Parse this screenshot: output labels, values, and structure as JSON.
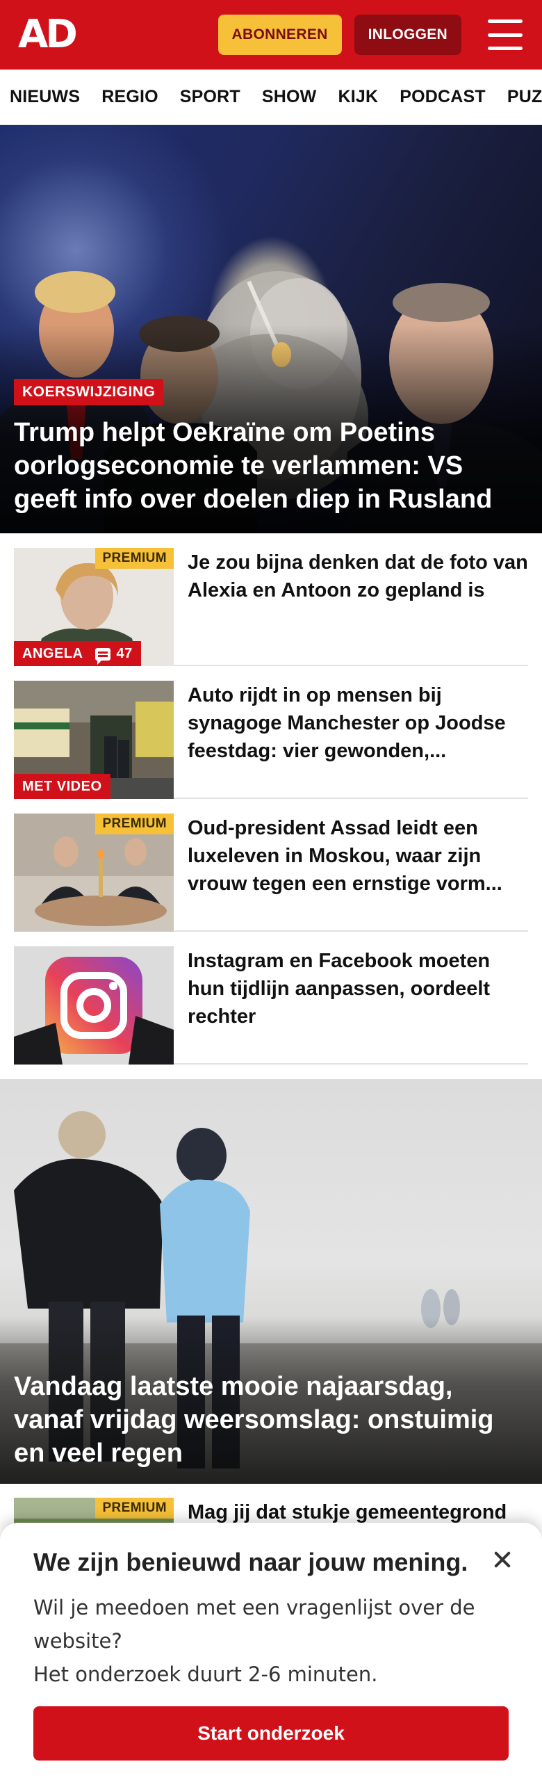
{
  "header": {
    "logo": "AD",
    "subscribe_label": "ABONNEREN",
    "login_label": "INLOGGEN",
    "menu_icon": "hamburger-menu-icon",
    "brand_color": "#d1111a",
    "subscribe_color": "#f6c038"
  },
  "nav": {
    "items": [
      "NIEUWS",
      "REGIO",
      "SPORT",
      "SHOW",
      "KIJK",
      "PODCAST",
      "PUZZ"
    ]
  },
  "hero": {
    "tag": "KOERSWIJZIGING",
    "title": "Trump helpt Oekraïne om Poetins oorlogseconomie te verlammen: VS geeft info over doelen diep in Rusland"
  },
  "articles": [
    {
      "title": "Je zou bijna denken dat de foto van Alexia en Antoon zo gepland is",
      "premium": "PREMIUM",
      "label": "ANGELA",
      "comments": "47",
      "comment_icon": "comment-bubble-icon"
    },
    {
      "title": "Auto rijdt in op mensen bij synagoge Manchester op Joodse feestdag: vier gewonden,...",
      "label": "MET VIDEO"
    },
    {
      "title": "Oud-president Assad leidt een luxeleven in Moskou, waar zijn vrouw tegen een ernstige vorm...",
      "premium": "PREMIUM"
    },
    {
      "title": "Instagram en Facebook moeten hun tijdlijn aanpassen, oordeelt rechter"
    }
  ],
  "hero2": {
    "title": "Vandaag laatste mooie najaarsdag, vanaf vrijdag weersomslag: onstuimig en veel regen"
  },
  "partial_article": {
    "title": "Mag jij dat stukje gemeentegrond",
    "premium": "PREMIUM"
  },
  "survey": {
    "title": "We zijn benieuwd naar jouw mening.",
    "line1": "Wil je meedoen met een vragenlijst over de website?",
    "line2": "Het onderzoek duurt 2-6 minuten.",
    "button": "Start onderzoek",
    "close_icon": "close-icon"
  }
}
